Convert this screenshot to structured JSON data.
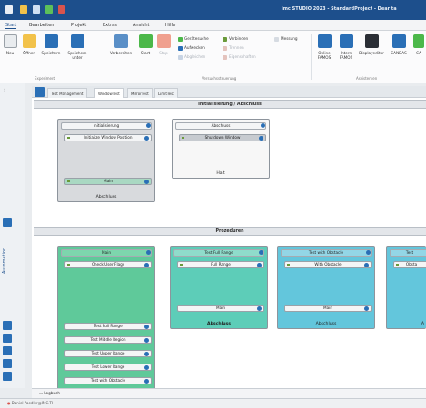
{
  "window": {
    "title": "imc STUDIO 2023 - StandardProject - Dear ta"
  },
  "menu": [
    "Start",
    "Bearbeiten",
    "Projekt",
    "Extras",
    "Ansicht",
    "Hilfe"
  ],
  "ribbon": {
    "buttons": {
      "neu": "Neu",
      "oeffnen": "Öffnen",
      "speichern": "Speichern",
      "speichern_unter": "Speichern unter",
      "vorbereiten": "Vorbereiten",
      "start": "Start",
      "stop": "Stop",
      "online_famos": "Online FAMOS",
      "intern_famos": "Intern FAMOS",
      "display_editor": "Displayeditor",
      "canoas": "CANDAS",
      "ca": "CA"
    },
    "small": {
      "geraetesuche": "Gerätesuche",
      "verbinden": "Verbinden",
      "aufwecken": "Aufwecken",
      "trennen": "Trennen",
      "abgleichen": "Abgleichen",
      "messung": "Messung",
      "eigenschaften": "Eigenschaften"
    },
    "groups": {
      "experiment": "Experiment",
      "versuchssteuerung": "Versuchssteuerung",
      "assistenten": "Assistenten"
    }
  },
  "sidebar": {
    "label": "Automation"
  },
  "tabs": [
    "Test Management",
    "WindowTest",
    "MirrorTest",
    "LimitTest"
  ],
  "sections": {
    "init": {
      "title": "Initialisierung / Abschluss",
      "blocks": [
        {
          "head": "Initialisierung",
          "step": "Initialize Window Position",
          "bar": "Main",
          "foot": "Abschluss"
        },
        {
          "head": "Abschluss",
          "step": "Shutdown Window",
          "foot": "Halt"
        }
      ]
    },
    "proc": {
      "title": "Prozeduren",
      "blocks": [
        {
          "head": "Main",
          "steps": [
            "Check User Flags",
            "Test Full Range",
            "Test Middle Region",
            "Test Upper Range",
            "Test Lower Range",
            "Test with Obstacle"
          ]
        },
        {
          "head": "Test Full Range",
          "step": "Full Range",
          "bar": "Main",
          "foot": "Abschluss"
        },
        {
          "head": "Test with Obstacle",
          "step": "With Obstacle",
          "bar": "Main",
          "foot": "Abschluss"
        },
        {
          "head": "Test",
          "step": "Obsta",
          "foot": "A"
        }
      ]
    }
  },
  "log": {
    "label": "Logbuch"
  },
  "status": {
    "user": "Daniel Paedler@IMC.TH"
  },
  "colors": {
    "titlebar": "#1d4f8c",
    "accent": "#2a6fb6",
    "green_block": "#5fc99a",
    "teal_block": "#5dcdb8",
    "cyan_block": "#63c6dc"
  }
}
